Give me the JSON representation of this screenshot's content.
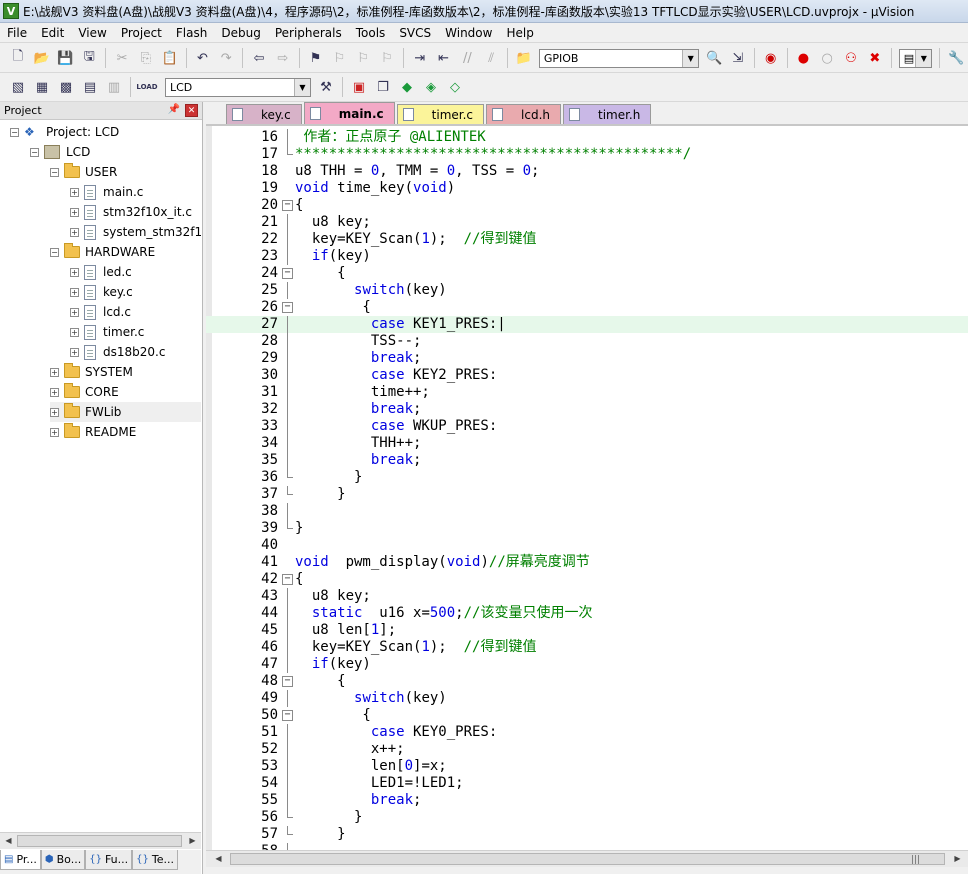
{
  "window": {
    "title": "E:\\战舰V3 资料盘(A盘)\\战舰V3 资料盘(A盘)\\4，程序源码\\2，标准例程-库函数版本\\2，标准例程-库函数版本\\实验13 TFTLCD显示实验\\USER\\LCD.uvprojx - µVision"
  },
  "menu": [
    "File",
    "Edit",
    "View",
    "Project",
    "Flash",
    "Debug",
    "Peripherals",
    "Tools",
    "SVCS",
    "Window",
    "Help"
  ],
  "toolbar": {
    "search_value": "GPIOB",
    "target_value": "LCD",
    "load_label": "LOAD"
  },
  "project_panel": {
    "title": "Project",
    "tree": [
      {
        "label": "Project: LCD",
        "kind": "project",
        "indent": 0,
        "expander": "−"
      },
      {
        "label": "LCD",
        "kind": "target",
        "indent": 1,
        "expander": "−"
      },
      {
        "label": "USER",
        "kind": "folder",
        "indent": 2,
        "expander": "−"
      },
      {
        "label": "main.c",
        "kind": "file",
        "indent": 3,
        "expander": "+"
      },
      {
        "label": "stm32f10x_it.c",
        "kind": "file",
        "indent": 3,
        "expander": "+"
      },
      {
        "label": "system_stm32f10x.c",
        "kind": "file",
        "indent": 3,
        "expander": "+"
      },
      {
        "label": "HARDWARE",
        "kind": "folder",
        "indent": 2,
        "expander": "−"
      },
      {
        "label": "led.c",
        "kind": "file",
        "indent": 3,
        "expander": "+"
      },
      {
        "label": "key.c",
        "kind": "file",
        "indent": 3,
        "expander": "+"
      },
      {
        "label": "lcd.c",
        "kind": "file",
        "indent": 3,
        "expander": "+"
      },
      {
        "label": "timer.c",
        "kind": "file",
        "indent": 3,
        "expander": "+"
      },
      {
        "label": "ds18b20.c",
        "kind": "file",
        "indent": 3,
        "expander": "+"
      },
      {
        "label": "SYSTEM",
        "kind": "folder",
        "indent": 2,
        "expander": "+"
      },
      {
        "label": "CORE",
        "kind": "folder",
        "indent": 2,
        "expander": "+"
      },
      {
        "label": "FWLib",
        "kind": "folder",
        "indent": 2,
        "expander": "+",
        "highlight": true
      },
      {
        "label": "README",
        "kind": "folder",
        "indent": 2,
        "expander": "+"
      }
    ],
    "bottom_tabs": [
      "Pr...",
      "Bo...",
      "Fu...",
      "Te..."
    ]
  },
  "editor_tabs": [
    {
      "label": "key.c",
      "color": "#d7b2c8",
      "active": false
    },
    {
      "label": "main.c",
      "color": "#f3a9c6",
      "active": true
    },
    {
      "label": "timer.c",
      "color": "#fbf49a",
      "active": false
    },
    {
      "label": "lcd.h",
      "color": "#e9aaae",
      "active": false
    },
    {
      "label": "timer.h",
      "color": "#c9b8e6",
      "active": false
    }
  ],
  "editor": {
    "current_line": 27,
    "lines": [
      {
        "n": "16",
        "f": "vl",
        "t": [
          [
            "cm",
            " 作者：正点原子 @ALIENTEK"
          ]
        ]
      },
      {
        "n": "17",
        "f": "end",
        "t": [
          [
            "cm",
            "**********************************************/"
          ]
        ]
      },
      {
        "n": "18",
        "f": "",
        "t": [
          [
            "nm",
            "u8 THH = "
          ],
          [
            "kw",
            "0"
          ],
          [
            "nm",
            ", TMM = "
          ],
          [
            "kw",
            "0"
          ],
          [
            "nm",
            ", TSS = "
          ],
          [
            "kw",
            "0"
          ],
          [
            "nm",
            ";"
          ]
        ]
      },
      {
        "n": "19",
        "f": "",
        "t": [
          [
            "kw",
            "void"
          ],
          [
            "nm",
            " time_key("
          ],
          [
            "kw",
            "void"
          ],
          [
            "nm",
            ")"
          ]
        ]
      },
      {
        "n": "20",
        "f": "box",
        "t": [
          [
            "nm",
            "{"
          ]
        ]
      },
      {
        "n": "21",
        "f": "vl",
        "t": [
          [
            "nm",
            "  u8 key;"
          ]
        ]
      },
      {
        "n": "22",
        "f": "vl",
        "t": [
          [
            "nm",
            "  key=KEY_Scan("
          ],
          [
            "kw",
            "1"
          ],
          [
            "nm",
            ");  "
          ],
          [
            "cm",
            "//得到键值"
          ]
        ]
      },
      {
        "n": "23",
        "f": "vl",
        "t": [
          [
            "nm",
            "  "
          ],
          [
            "kw",
            "if"
          ],
          [
            "nm",
            "(key)"
          ]
        ]
      },
      {
        "n": "24",
        "f": "box",
        "t": [
          [
            "nm",
            "     {"
          ]
        ]
      },
      {
        "n": "25",
        "f": "vl",
        "t": [
          [
            "nm",
            "       "
          ],
          [
            "kw",
            "switch"
          ],
          [
            "nm",
            "(key)"
          ]
        ]
      },
      {
        "n": "26",
        "f": "box",
        "t": [
          [
            "nm",
            "        {"
          ]
        ]
      },
      {
        "n": "27",
        "f": "vl",
        "t": [
          [
            "nm",
            "         "
          ],
          [
            "kw",
            "case"
          ],
          [
            "nm",
            " KEY1_PRES:|"
          ]
        ]
      },
      {
        "n": "28",
        "f": "vl",
        "t": [
          [
            "nm",
            "         TSS--;"
          ]
        ]
      },
      {
        "n": "29",
        "f": "vl",
        "t": [
          [
            "nm",
            "         "
          ],
          [
            "kw",
            "break"
          ],
          [
            "nm",
            ";"
          ]
        ]
      },
      {
        "n": "30",
        "f": "vl",
        "t": [
          [
            "nm",
            "         "
          ],
          [
            "kw",
            "case"
          ],
          [
            "nm",
            " KEY2_PRES:"
          ]
        ]
      },
      {
        "n": "31",
        "f": "vl",
        "t": [
          [
            "nm",
            "         time++;"
          ]
        ]
      },
      {
        "n": "32",
        "f": "vl",
        "t": [
          [
            "nm",
            "         "
          ],
          [
            "kw",
            "break"
          ],
          [
            "nm",
            ";"
          ]
        ]
      },
      {
        "n": "33",
        "f": "vl",
        "t": [
          [
            "nm",
            "         "
          ],
          [
            "kw",
            "case"
          ],
          [
            "nm",
            " WKUP_PRES:"
          ]
        ]
      },
      {
        "n": "34",
        "f": "vl",
        "t": [
          [
            "nm",
            "         THH++;"
          ]
        ]
      },
      {
        "n": "35",
        "f": "vl",
        "t": [
          [
            "nm",
            "         "
          ],
          [
            "kw",
            "break"
          ],
          [
            "nm",
            ";"
          ]
        ]
      },
      {
        "n": "36",
        "f": "end",
        "t": [
          [
            "nm",
            "       }"
          ]
        ]
      },
      {
        "n": "37",
        "f": "end",
        "t": [
          [
            "nm",
            "     }"
          ]
        ]
      },
      {
        "n": "38",
        "f": "vl",
        "t": [
          [
            "nm",
            ""
          ]
        ]
      },
      {
        "n": "39",
        "f": "end",
        "t": [
          [
            "nm",
            "}"
          ]
        ]
      },
      {
        "n": "40",
        "f": "",
        "t": [
          [
            "nm",
            ""
          ]
        ]
      },
      {
        "n": "41",
        "f": "",
        "t": [
          [
            "kw",
            "void"
          ],
          [
            "nm",
            "  pwm_display("
          ],
          [
            "kw",
            "void"
          ],
          [
            "nm",
            ")"
          ],
          [
            "cm",
            "//屏幕亮度调节"
          ]
        ]
      },
      {
        "n": "42",
        "f": "box",
        "t": [
          [
            "nm",
            "{"
          ]
        ]
      },
      {
        "n": "43",
        "f": "vl",
        "t": [
          [
            "nm",
            "  u8 key;"
          ]
        ]
      },
      {
        "n": "44",
        "f": "vl",
        "t": [
          [
            "nm",
            "  "
          ],
          [
            "kw",
            "static"
          ],
          [
            "nm",
            "  u16 x="
          ],
          [
            "kw",
            "500"
          ],
          [
            "nm",
            ";"
          ],
          [
            "cm",
            "//该变量只使用一次"
          ]
        ]
      },
      {
        "n": "45",
        "f": "vl",
        "t": [
          [
            "nm",
            "  u8 len["
          ],
          [
            "kw",
            "1"
          ],
          [
            "nm",
            "];"
          ]
        ]
      },
      {
        "n": "46",
        "f": "vl",
        "t": [
          [
            "nm",
            "  key=KEY_Scan("
          ],
          [
            "kw",
            "1"
          ],
          [
            "nm",
            ");  "
          ],
          [
            "cm",
            "//得到键值"
          ]
        ]
      },
      {
        "n": "47",
        "f": "vl",
        "t": [
          [
            "nm",
            "  "
          ],
          [
            "kw",
            "if"
          ],
          [
            "nm",
            "(key)"
          ]
        ]
      },
      {
        "n": "48",
        "f": "box",
        "t": [
          [
            "nm",
            "     {"
          ]
        ]
      },
      {
        "n": "49",
        "f": "vl",
        "t": [
          [
            "nm",
            "       "
          ],
          [
            "kw",
            "switch"
          ],
          [
            "nm",
            "(key)"
          ]
        ]
      },
      {
        "n": "50",
        "f": "box",
        "t": [
          [
            "nm",
            "        {"
          ]
        ]
      },
      {
        "n": "51",
        "f": "vl",
        "t": [
          [
            "nm",
            "         "
          ],
          [
            "kw",
            "case"
          ],
          [
            "nm",
            " KEY0_PRES:"
          ]
        ]
      },
      {
        "n": "52",
        "f": "vl",
        "t": [
          [
            "nm",
            "         x++;"
          ]
        ]
      },
      {
        "n": "53",
        "f": "vl",
        "t": [
          [
            "nm",
            "         len["
          ],
          [
            "kw",
            "0"
          ],
          [
            "nm",
            "]=x;"
          ]
        ]
      },
      {
        "n": "54",
        "f": "vl",
        "t": [
          [
            "nm",
            "         LED1=!LED1;"
          ]
        ]
      },
      {
        "n": "55",
        "f": "vl",
        "t": [
          [
            "nm",
            "         "
          ],
          [
            "kw",
            "break"
          ],
          [
            "nm",
            ";"
          ]
        ]
      },
      {
        "n": "56",
        "f": "end",
        "t": [
          [
            "nm",
            "       }"
          ]
        ]
      },
      {
        "n": "57",
        "f": "end",
        "t": [
          [
            "nm",
            "     }"
          ]
        ]
      },
      {
        "n": "58",
        "f": "vl",
        "t": [
          [
            "nm",
            ""
          ]
        ]
      }
    ]
  }
}
